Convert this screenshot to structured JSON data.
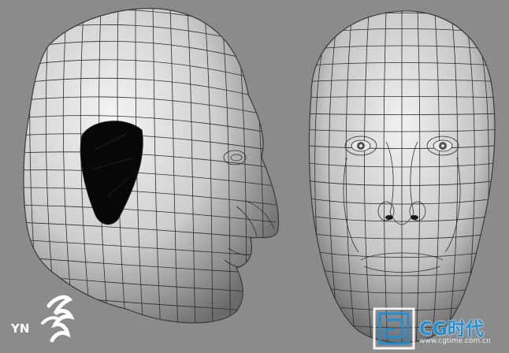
{
  "image": {
    "subjects": [
      "side-head-mesh",
      "front-head-mesh"
    ],
    "background_color": "#8b8b8b",
    "mesh_color": "#2c2c2c"
  },
  "watermarks": {
    "left_logo_text": "YN",
    "right_brand_text": "CG时代",
    "right_brand_url": "www.cgtime.com.cn",
    "brand_color": "#1e8ed6"
  }
}
